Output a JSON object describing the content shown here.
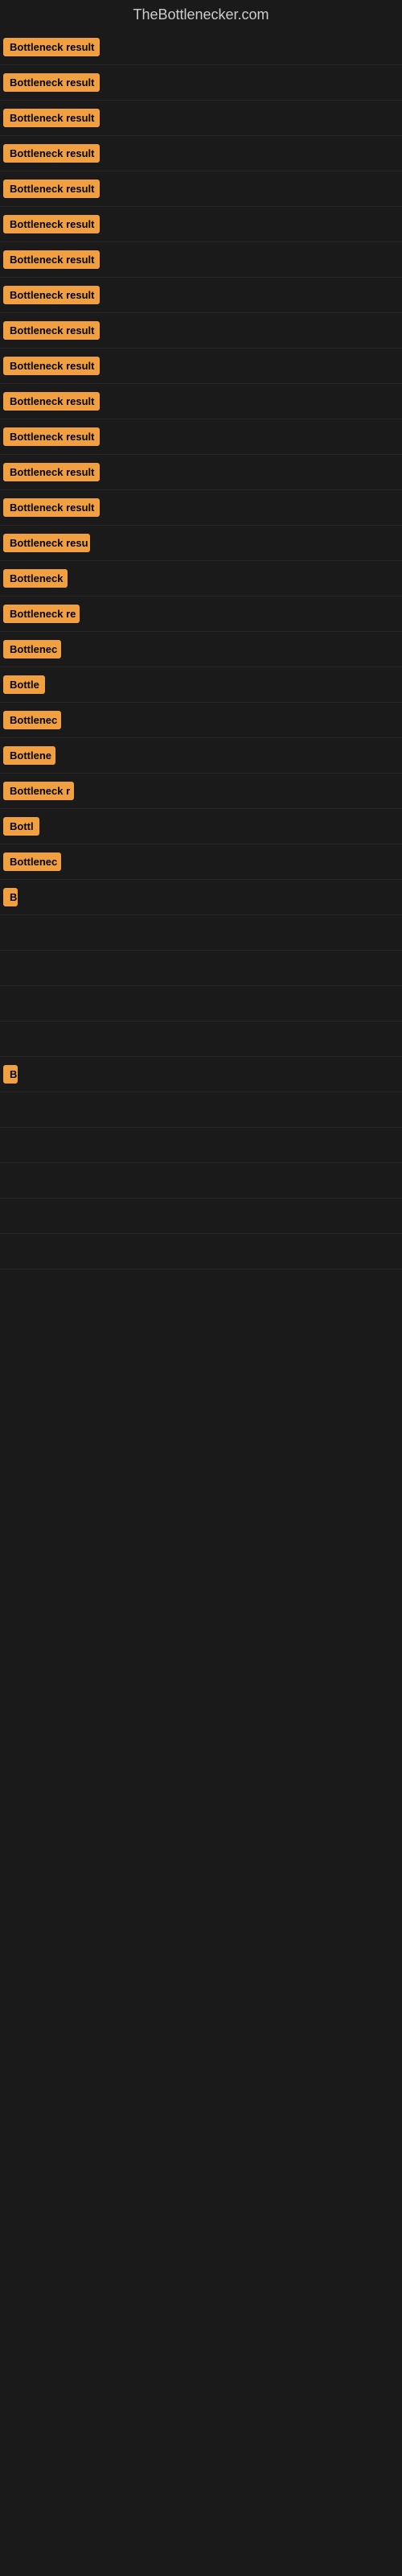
{
  "header": {
    "title": "TheBottlenecker.com"
  },
  "badges": [
    {
      "id": 1,
      "label": "Bottleneck result",
      "width": 120
    },
    {
      "id": 2,
      "label": "Bottleneck result",
      "width": 120
    },
    {
      "id": 3,
      "label": "Bottleneck result",
      "width": 120
    },
    {
      "id": 4,
      "label": "Bottleneck result",
      "width": 120
    },
    {
      "id": 5,
      "label": "Bottleneck result",
      "width": 120
    },
    {
      "id": 6,
      "label": "Bottleneck result",
      "width": 120
    },
    {
      "id": 7,
      "label": "Bottleneck result",
      "width": 120
    },
    {
      "id": 8,
      "label": "Bottleneck result",
      "width": 120
    },
    {
      "id": 9,
      "label": "Bottleneck result",
      "width": 120
    },
    {
      "id": 10,
      "label": "Bottleneck result",
      "width": 120
    },
    {
      "id": 11,
      "label": "Bottleneck result",
      "width": 120
    },
    {
      "id": 12,
      "label": "Bottleneck result",
      "width": 120
    },
    {
      "id": 13,
      "label": "Bottleneck result",
      "width": 120
    },
    {
      "id": 14,
      "label": "Bottleneck result",
      "width": 120
    },
    {
      "id": 15,
      "label": "Bottleneck resu",
      "width": 108
    },
    {
      "id": 16,
      "label": "Bottleneck",
      "width": 80
    },
    {
      "id": 17,
      "label": "Bottleneck re",
      "width": 95
    },
    {
      "id": 18,
      "label": "Bottlenec",
      "width": 72
    },
    {
      "id": 19,
      "label": "Bottle",
      "width": 52
    },
    {
      "id": 20,
      "label": "Bottlenec",
      "width": 72
    },
    {
      "id": 21,
      "label": "Bottlene",
      "width": 65
    },
    {
      "id": 22,
      "label": "Bottleneck r",
      "width": 88
    },
    {
      "id": 23,
      "label": "Bottl",
      "width": 45
    },
    {
      "id": 24,
      "label": "Bottlenec",
      "width": 72
    },
    {
      "id": 25,
      "label": "B",
      "width": 18
    },
    {
      "id": 26,
      "label": "",
      "width": 0
    },
    {
      "id": 27,
      "label": "",
      "width": 0
    },
    {
      "id": 28,
      "label": "",
      "width": 0
    },
    {
      "id": 29,
      "label": "",
      "width": 0
    },
    {
      "id": 30,
      "label": "B",
      "width": 18
    },
    {
      "id": 31,
      "label": "",
      "width": 0
    },
    {
      "id": 32,
      "label": "",
      "width": 0
    },
    {
      "id": 33,
      "label": "",
      "width": 0
    },
    {
      "id": 34,
      "label": "",
      "width": 0
    },
    {
      "id": 35,
      "label": "",
      "width": 0
    }
  ],
  "colors": {
    "badge_bg": "#f0a040",
    "badge_text": "#000000",
    "page_bg": "#1a1a1a",
    "header_text": "#cccccc"
  }
}
